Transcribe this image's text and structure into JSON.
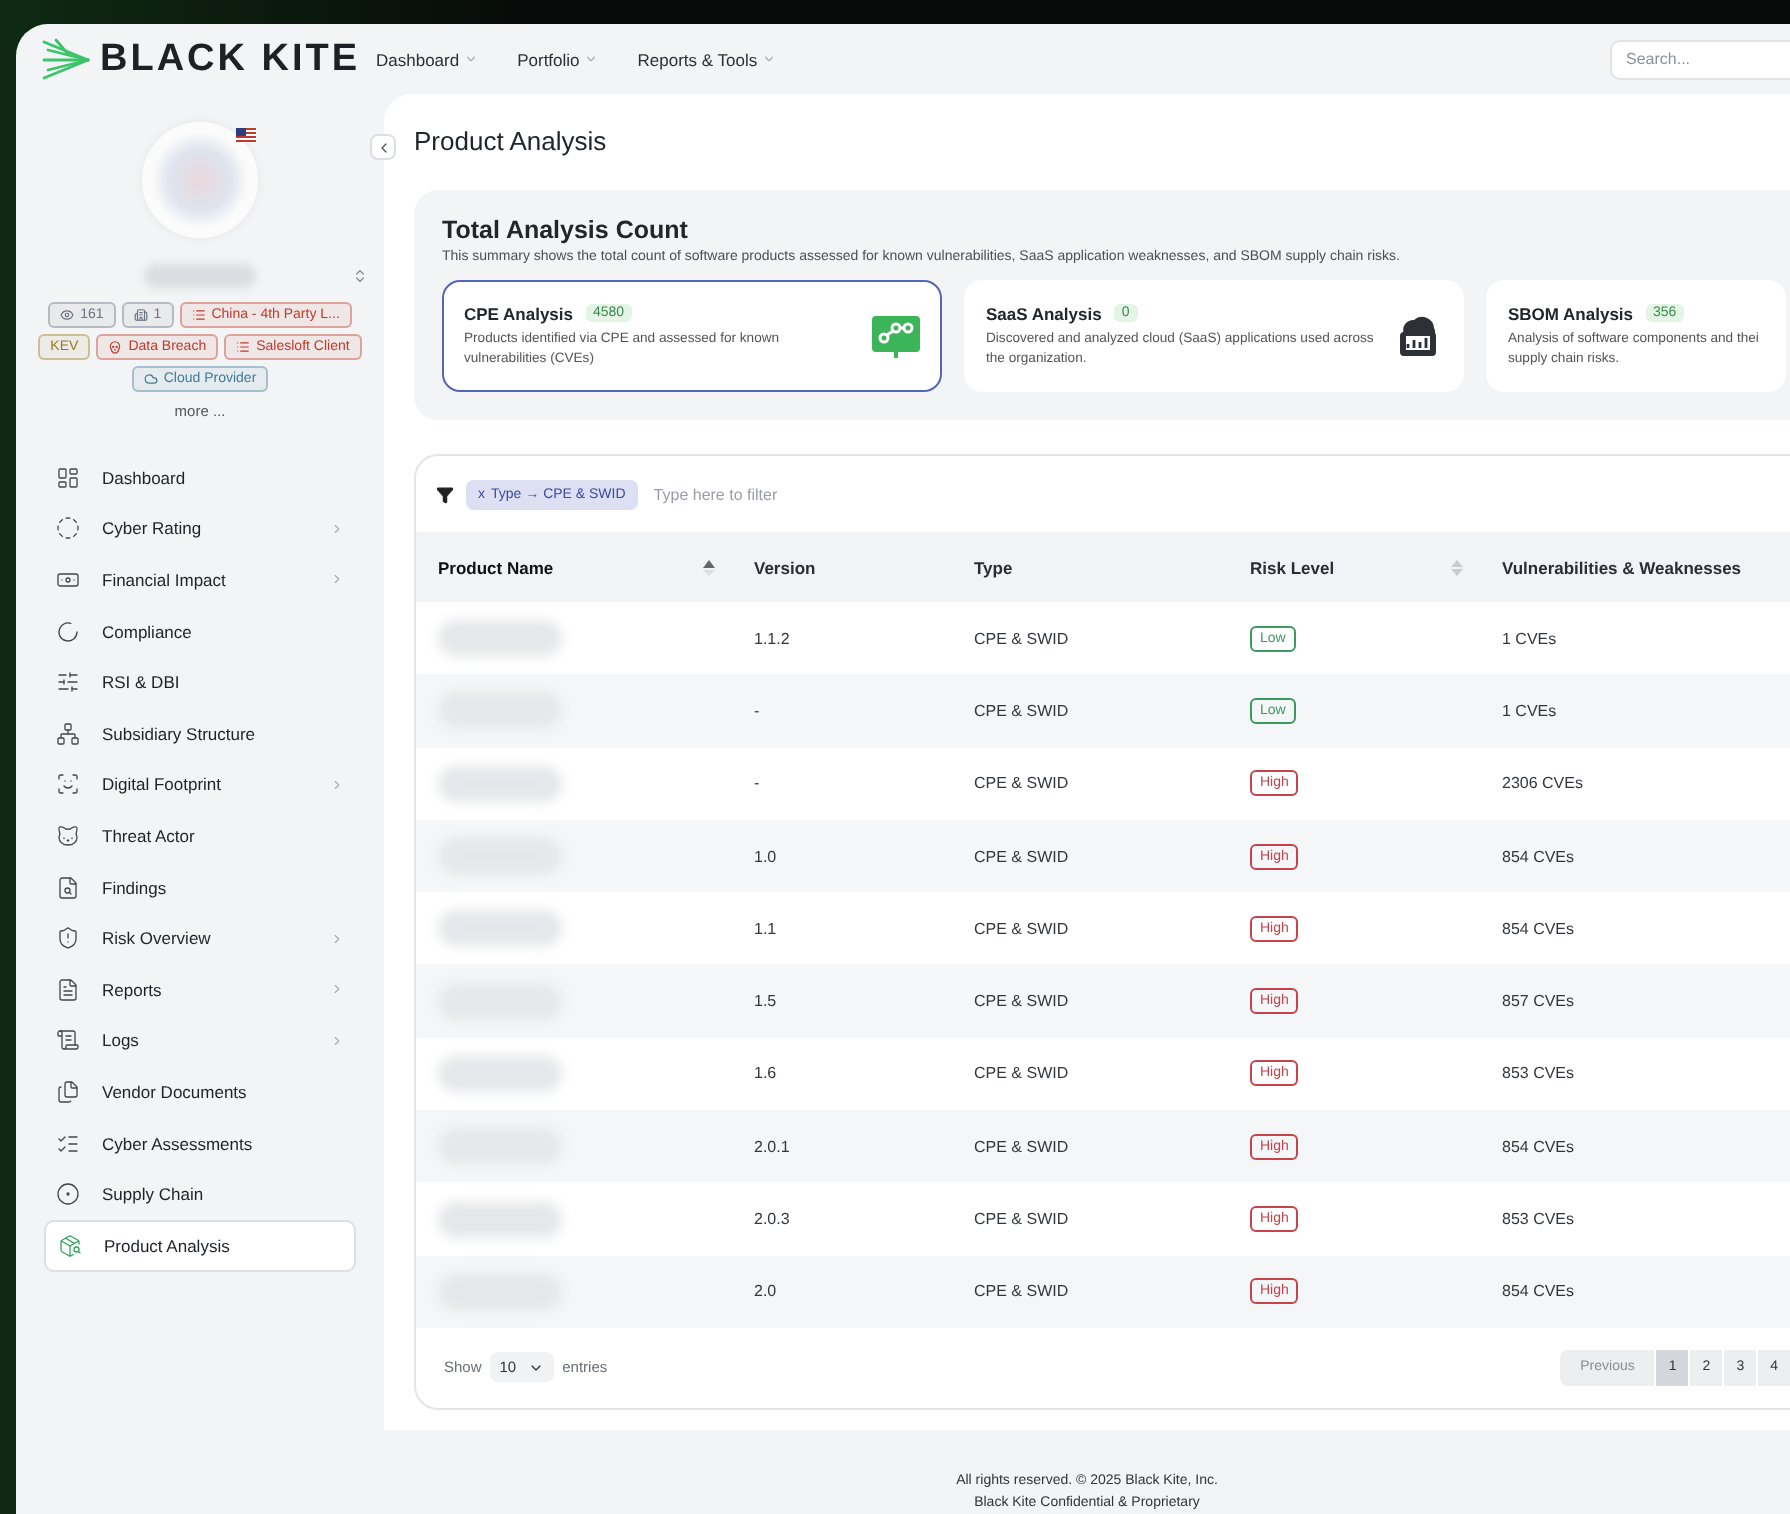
{
  "brand": {
    "name": "BLACK KITE"
  },
  "nav": [
    {
      "label": "Dashboard"
    },
    {
      "label": "Portfolio"
    },
    {
      "label": "Reports & Tools"
    }
  ],
  "search": {
    "placeholder": "Search..."
  },
  "profile": {
    "tags": [
      {
        "label": "161",
        "color": "#6b7280"
      },
      {
        "label": "1",
        "color": "#6b7280"
      },
      {
        "label": "China - 4th Party L...",
        "color": "#c0392b"
      },
      {
        "label": "KEV",
        "color": "#9a7b1c"
      },
      {
        "label": "Data Breach",
        "color": "#c0392b"
      },
      {
        "label": "Salesloft Client",
        "color": "#c0392b"
      },
      {
        "label": "Cloud Provider",
        "color": "#3f7c99"
      }
    ],
    "more": "more ..."
  },
  "sidebar": {
    "items": [
      {
        "label": "Dashboard",
        "expandable": false,
        "selected": false
      },
      {
        "label": "Cyber Rating",
        "expandable": true,
        "selected": false
      },
      {
        "label": "Financial Impact",
        "expandable": true,
        "selected": false
      },
      {
        "label": "Compliance",
        "expandable": false,
        "selected": false
      },
      {
        "label": "RSI & DBI",
        "expandable": false,
        "selected": false
      },
      {
        "label": "Subsidiary Structure",
        "expandable": false,
        "selected": false
      },
      {
        "label": "Digital Footprint",
        "expandable": true,
        "selected": false
      },
      {
        "label": "Threat Actor",
        "expandable": false,
        "selected": false
      },
      {
        "label": "Findings",
        "expandable": false,
        "selected": false
      },
      {
        "label": "Risk Overview",
        "expandable": true,
        "selected": false
      },
      {
        "label": "Reports",
        "expandable": true,
        "selected": false
      },
      {
        "label": "Logs",
        "expandable": true,
        "selected": false
      },
      {
        "label": "Vendor Documents",
        "expandable": false,
        "selected": false
      },
      {
        "label": "Cyber Assessments",
        "expandable": false,
        "selected": false
      },
      {
        "label": "Supply Chain",
        "expandable": false,
        "selected": false
      },
      {
        "label": "Product Analysis",
        "expandable": false,
        "selected": true
      }
    ]
  },
  "page": {
    "title": "Product Analysis"
  },
  "summary": {
    "title": "Total Analysis Count",
    "description": "This summary shows the total count of software products assessed for known vulnerabilities, SaaS application weaknesses, and SBOM supply chain risks.",
    "cards": [
      {
        "kind": "cpe",
        "title": "CPE Analysis",
        "count": "4580",
        "description": "Products identified via CPE and assessed for known vulnerabilities (CVEs)",
        "selected": true
      },
      {
        "kind": "saas",
        "title": "SaaS Analysis",
        "count": "0",
        "description": "Discovered and analyzed cloud (SaaS) applications used across the organization.",
        "selected": false
      },
      {
        "kind": "sbom",
        "title": "SBOM Analysis",
        "count": "356",
        "description": "Analysis of software components and thei supply chain risks.",
        "selected": false
      }
    ]
  },
  "filter": {
    "chip_remove": "x",
    "chip_label": "Type → CPE & SWID",
    "placeholder": "Type here to filter"
  },
  "table": {
    "columns": [
      {
        "label": "Product Name",
        "sortable": true,
        "sorted": true
      },
      {
        "label": "Version",
        "sortable": false,
        "sorted": false
      },
      {
        "label": "Type",
        "sortable": false,
        "sorted": false
      },
      {
        "label": "Risk Level",
        "sortable": true,
        "sorted": false
      },
      {
        "label": "Vulnerabilities & Weaknesses",
        "sortable": false,
        "sorted": false
      }
    ],
    "rows": [
      {
        "version": "1.1.2",
        "type": "CPE & SWID",
        "risk": "Low",
        "high_risk": false,
        "vulnerabilities": "1 CVEs"
      },
      {
        "version": "-",
        "type": "CPE & SWID",
        "risk": "Low",
        "high_risk": false,
        "vulnerabilities": "1 CVEs"
      },
      {
        "version": "-",
        "type": "CPE & SWID",
        "risk": "High",
        "high_risk": true,
        "vulnerabilities": "2306 CVEs"
      },
      {
        "version": "1.0",
        "type": "CPE & SWID",
        "risk": "High",
        "high_risk": true,
        "vulnerabilities": "854 CVEs"
      },
      {
        "version": "1.1",
        "type": "CPE & SWID",
        "risk": "High",
        "high_risk": true,
        "vulnerabilities": "854 CVEs"
      },
      {
        "version": "1.5",
        "type": "CPE & SWID",
        "risk": "High",
        "high_risk": true,
        "vulnerabilities": "857 CVEs"
      },
      {
        "version": "1.6",
        "type": "CPE & SWID",
        "risk": "High",
        "high_risk": true,
        "vulnerabilities": "853 CVEs"
      },
      {
        "version": "2.0.1",
        "type": "CPE & SWID",
        "risk": "High",
        "high_risk": true,
        "vulnerabilities": "854 CVEs"
      },
      {
        "version": "2.0.3",
        "type": "CPE & SWID",
        "risk": "High",
        "high_risk": true,
        "vulnerabilities": "853 CVEs"
      },
      {
        "version": "2.0",
        "type": "CPE & SWID",
        "risk": "High",
        "high_risk": true,
        "vulnerabilities": "854 CVEs"
      }
    ]
  },
  "entries": {
    "show": "Show",
    "value": "10",
    "suffix": "entries"
  },
  "pagination": {
    "previous": "Previous",
    "pages": [
      {
        "label": "1",
        "selected": true
      },
      {
        "label": "2",
        "selected": false
      },
      {
        "label": "3",
        "selected": false
      },
      {
        "label": "4",
        "selected": false
      }
    ]
  },
  "footer": {
    "lines": [
      "All rights reserved. © 2025 Black Kite, Inc.",
      "Black Kite Confidential & Proprietary"
    ]
  }
}
